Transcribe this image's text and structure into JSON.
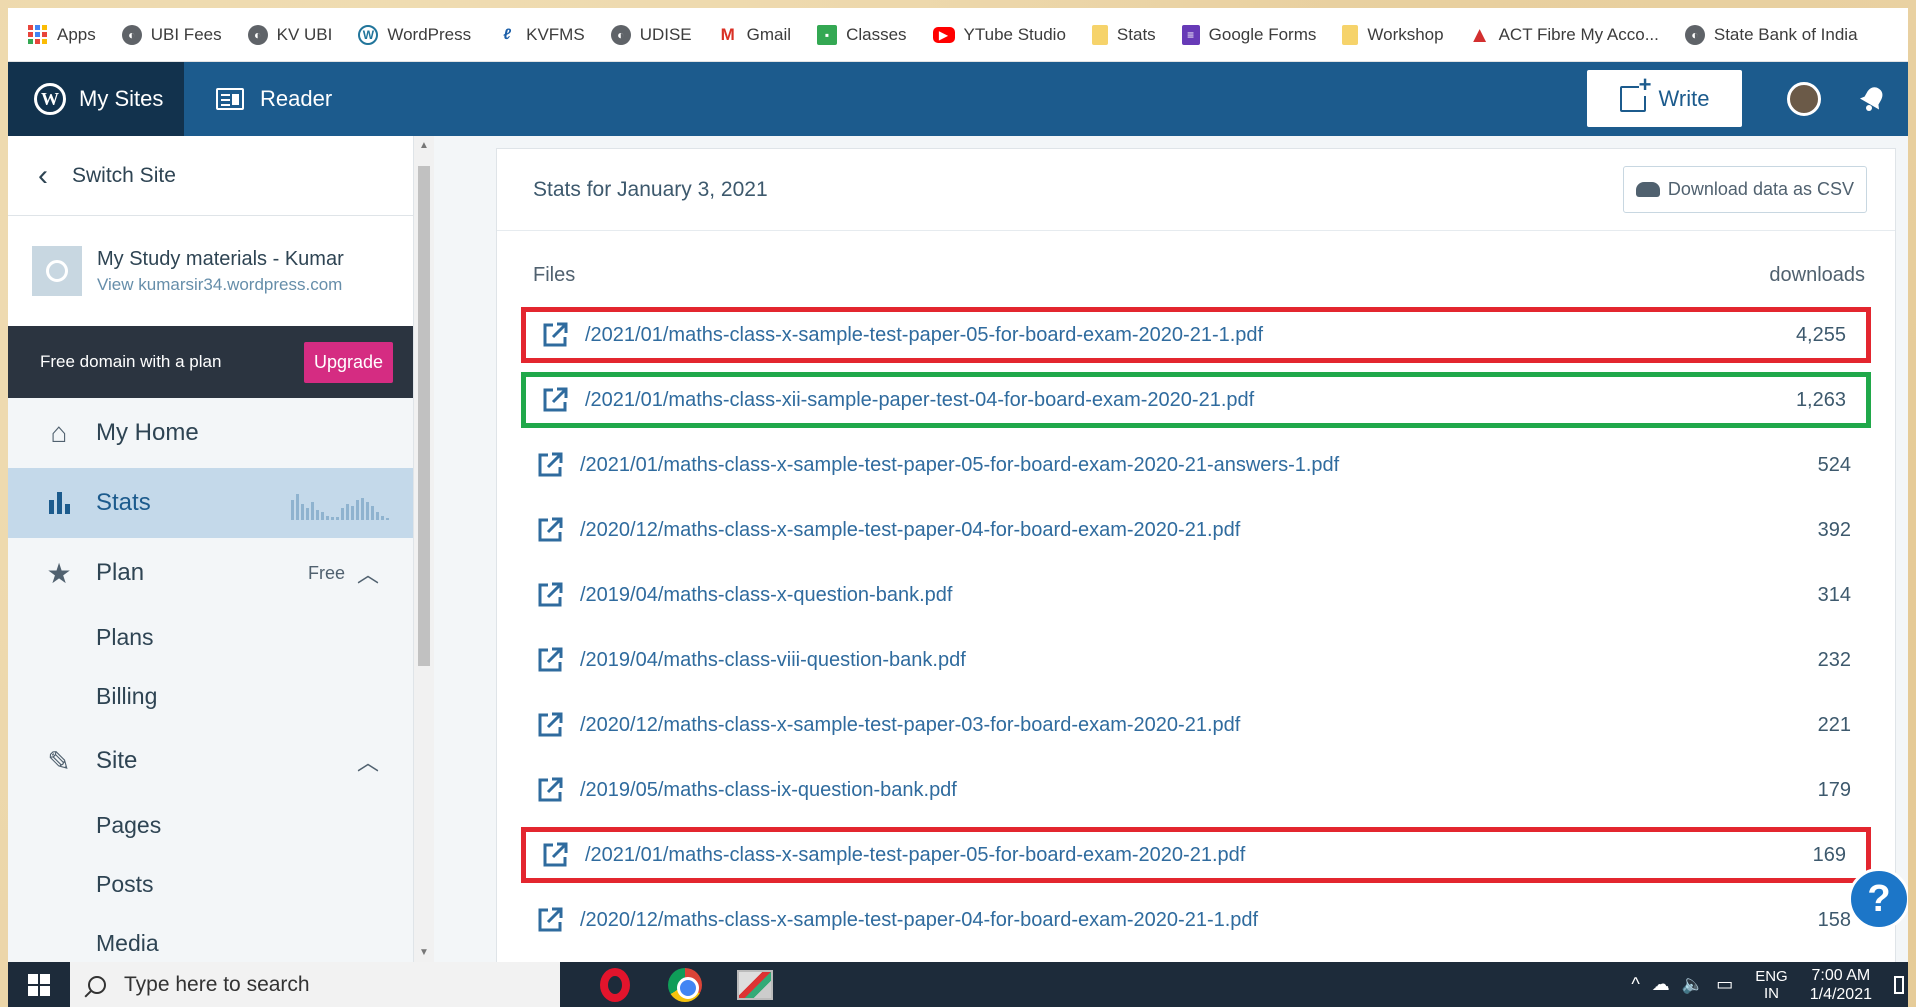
{
  "bookmarks": [
    {
      "label": "Apps",
      "icon": "apps-grid-icon"
    },
    {
      "label": "UBI Fees",
      "icon": "globe-icon"
    },
    {
      "label": "KV UBI",
      "icon": "globe-icon"
    },
    {
      "label": "WordPress",
      "icon": "wordpress-icon"
    },
    {
      "label": "KVFMS",
      "icon": "kvfms-icon"
    },
    {
      "label": "UDISE",
      "icon": "globe-icon"
    },
    {
      "label": "Gmail",
      "icon": "gmail-icon"
    },
    {
      "label": "Classes",
      "icon": "classroom-icon"
    },
    {
      "label": "YTube Studio",
      "icon": "youtube-icon"
    },
    {
      "label": "Stats",
      "icon": "folder-icon"
    },
    {
      "label": "Google Forms",
      "icon": "forms-icon"
    },
    {
      "label": "Workshop",
      "icon": "folder-icon"
    },
    {
      "label": "ACT Fibre My Acco...",
      "icon": "act-icon"
    },
    {
      "label": "State Bank of India",
      "icon": "globe-icon"
    }
  ],
  "masterbar": {
    "my_sites": "My Sites",
    "reader": "Reader",
    "write": "Write"
  },
  "sidebar": {
    "switch_site": "Switch Site",
    "site_title": "My Study materials - Kumar",
    "site_url": "View kumarsir34.wordpress.com",
    "promo_text": "Free domain with a plan",
    "upgrade": "Upgrade",
    "my_home": "My Home",
    "stats": "Stats",
    "plan": "Plan",
    "plan_badge": "Free",
    "plans": "Plans",
    "billing": "Billing",
    "site": "Site",
    "pages": "Pages",
    "posts": "Posts",
    "media": "Media"
  },
  "main": {
    "stats_title": "Stats for January 3, 2021",
    "download_csv": "Download data as CSV",
    "files_header": "Files",
    "downloads_header": "downloads",
    "files": [
      {
        "path": "/2021/01/maths-class-x-sample-test-paper-05-for-board-exam-2020-21-1.pdf",
        "downloads": "4,255",
        "highlight": "red"
      },
      {
        "path": "/2021/01/maths-class-xii-sample-paper-test-04-for-board-exam-2020-21.pdf",
        "downloads": "1,263",
        "highlight": "green"
      },
      {
        "path": "/2021/01/maths-class-x-sample-test-paper-05-for-board-exam-2020-21-answers-1.pdf",
        "downloads": "524",
        "highlight": ""
      },
      {
        "path": "/2020/12/maths-class-x-sample-test-paper-04-for-board-exam-2020-21.pdf",
        "downloads": "392",
        "highlight": ""
      },
      {
        "path": "/2019/04/maths-class-x-question-bank.pdf",
        "downloads": "314",
        "highlight": ""
      },
      {
        "path": "/2019/04/maths-class-viii-question-bank.pdf",
        "downloads": "232",
        "highlight": ""
      },
      {
        "path": "/2020/12/maths-class-x-sample-test-paper-03-for-board-exam-2020-21.pdf",
        "downloads": "221",
        "highlight": ""
      },
      {
        "path": "/2019/05/maths-class-ix-question-bank.pdf",
        "downloads": "179",
        "highlight": ""
      },
      {
        "path": "/2021/01/maths-class-x-sample-test-paper-05-for-board-exam-2020-21.pdf",
        "downloads": "169",
        "highlight": "red"
      },
      {
        "path": "/2020/12/maths-class-x-sample-test-paper-04-for-board-exam-2020-21-1.pdf",
        "downloads": "158",
        "highlight": ""
      }
    ]
  },
  "help_label": "?",
  "taskbar": {
    "search_placeholder": "Type here to search",
    "lang_top": "ENG",
    "lang_bottom": "IN",
    "time": "7:00 AM",
    "date": "1/4/2021"
  },
  "colors": {
    "wp_blue": "#1c5b8d",
    "highlight_red": "#e3262f",
    "highlight_green": "#20a84a",
    "upgrade_pink": "#d52c82"
  }
}
